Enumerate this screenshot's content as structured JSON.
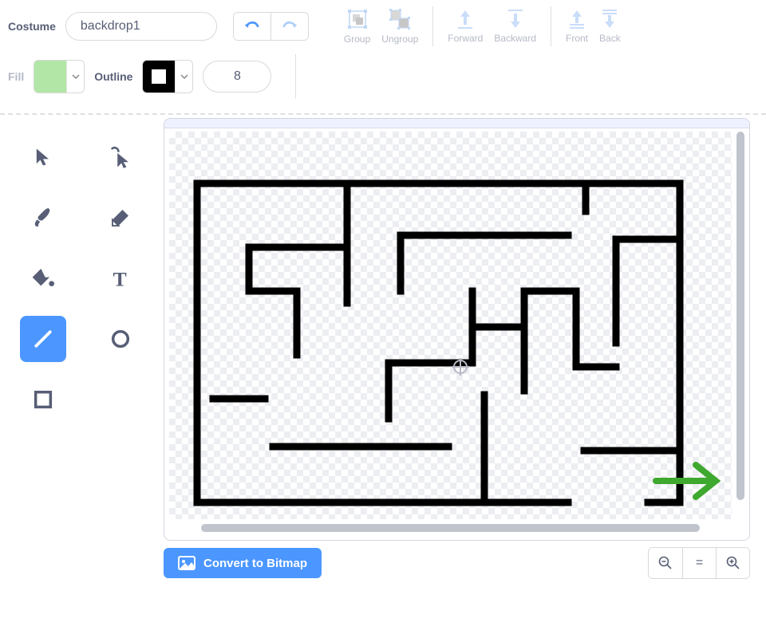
{
  "costume_label": "Costume",
  "costume_name": "backdrop1",
  "toolbar": {
    "group": "Group",
    "ungroup": "Ungroup",
    "forward": "Forward",
    "backward": "Backward",
    "front": "Front",
    "back": "Back"
  },
  "fill_label": "Fill",
  "outline_label": "Outline",
  "stroke_width": "8",
  "fill_color": "#b1e6a6",
  "outline_color": "#000000",
  "convert_label": "Convert to Bitmap",
  "tools": {
    "select": "Select",
    "reshape": "Reshape",
    "brush": "Brush",
    "eraser": "Eraser",
    "fill": "Fill",
    "text": "Text",
    "line": "Line",
    "circle": "Circle",
    "rectangle": "Rectangle"
  },
  "zoom": {
    "out": "−",
    "reset": "=",
    "in": "+"
  }
}
